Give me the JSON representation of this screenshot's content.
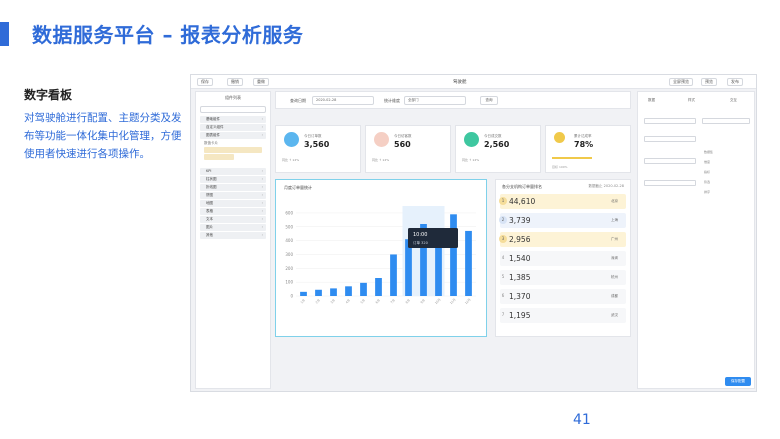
{
  "header": {
    "title": "数据服务平台 – 报表分析服务"
  },
  "section": {
    "title": "数字看板",
    "description": "对驾驶舱进行配置、主题分类及发布等功能一体化集中化管理，方便使用者快速进行各项操作。"
  },
  "page_number": "41",
  "colors": {
    "accent": "#2f6bd8",
    "bar": "#2f8cf0",
    "highlight_border": "#7fd1ea"
  },
  "screenshot": {
    "topbar": {
      "buttons": [
        "保存",
        "撤销",
        "重做"
      ],
      "title": "驾驶舱",
      "right_buttons": [
        "全屏预览",
        "预览",
        "发布"
      ]
    },
    "sidebar": {
      "title": "组件列表",
      "items": [
        "基础组件",
        "自定义组件",
        "图表组件",
        "KPI",
        "柱状图",
        "折线图",
        "饼图",
        "地图",
        "表格",
        "文本",
        "图片",
        "其他"
      ],
      "sub_items": [
        "数值卡片"
      ]
    },
    "filters": {
      "label1": "查询日期",
      "value1": "2020-02-28",
      "label2": "统计维度",
      "value2": "全部门",
      "query_button": "查询"
    },
    "kpis": [
      {
        "label": "今日订单数",
        "value": "3,560",
        "sub": "同比 ↑ 12%",
        "icon": "cart-icon",
        "color": "#5bb6ef"
      },
      {
        "label": "今日访客数",
        "value": "560",
        "sub": "同比 ↑ 12%",
        "icon": "user-icon",
        "color": "#f5cfc4"
      },
      {
        "label": "今日成交数",
        "value": "2,560",
        "sub": "同比 ↑ 12%",
        "icon": "deal-icon",
        "color": "#3ec7a0"
      },
      {
        "label": "累计达成率",
        "value": "78%",
        "sub": "目标 100%",
        "icon": "target-icon",
        "color": "#f0c94a"
      }
    ],
    "chart": {
      "title": "月度订单量统计",
      "tooltip": {
        "title": "10:00",
        "text": "订单 320"
      }
    },
    "ranking": {
      "title": "各分支机构订单量排名",
      "meta": "数据截止 2020-02-28",
      "rows": [
        {
          "rank": "1",
          "value": "44,610",
          "tag": "北京"
        },
        {
          "rank": "2",
          "value": "3,739",
          "tag": "上海"
        },
        {
          "rank": "3",
          "value": "2,956",
          "tag": "广州"
        },
        {
          "rank": "4",
          "value": "1,540",
          "tag": "深圳"
        },
        {
          "rank": "5",
          "value": "1,385",
          "tag": "杭州"
        },
        {
          "rank": "6",
          "value": "1,370",
          "tag": "成都"
        },
        {
          "rank": "7",
          "value": "1,195",
          "tag": "武汉"
        }
      ]
    },
    "right_panel": {
      "tabs": [
        "数据",
        "样式",
        "交互"
      ],
      "submit": "保存配置",
      "items": [
        "数据集",
        "维度",
        "指标",
        "筛选",
        "排序"
      ]
    }
  },
  "chart_data": {
    "type": "bar",
    "categories": [
      "1月",
      "2月",
      "3月",
      "4月",
      "5月",
      "6月",
      "7月",
      "8月",
      "9月",
      "10月",
      "11月",
      "12月"
    ],
    "values": [
      30,
      45,
      55,
      70,
      95,
      130,
      300,
      410,
      520,
      490,
      590,
      470
    ],
    "yticks": [
      0,
      100,
      200,
      300,
      400,
      500,
      600
    ],
    "ylim": [
      0,
      650
    ]
  }
}
